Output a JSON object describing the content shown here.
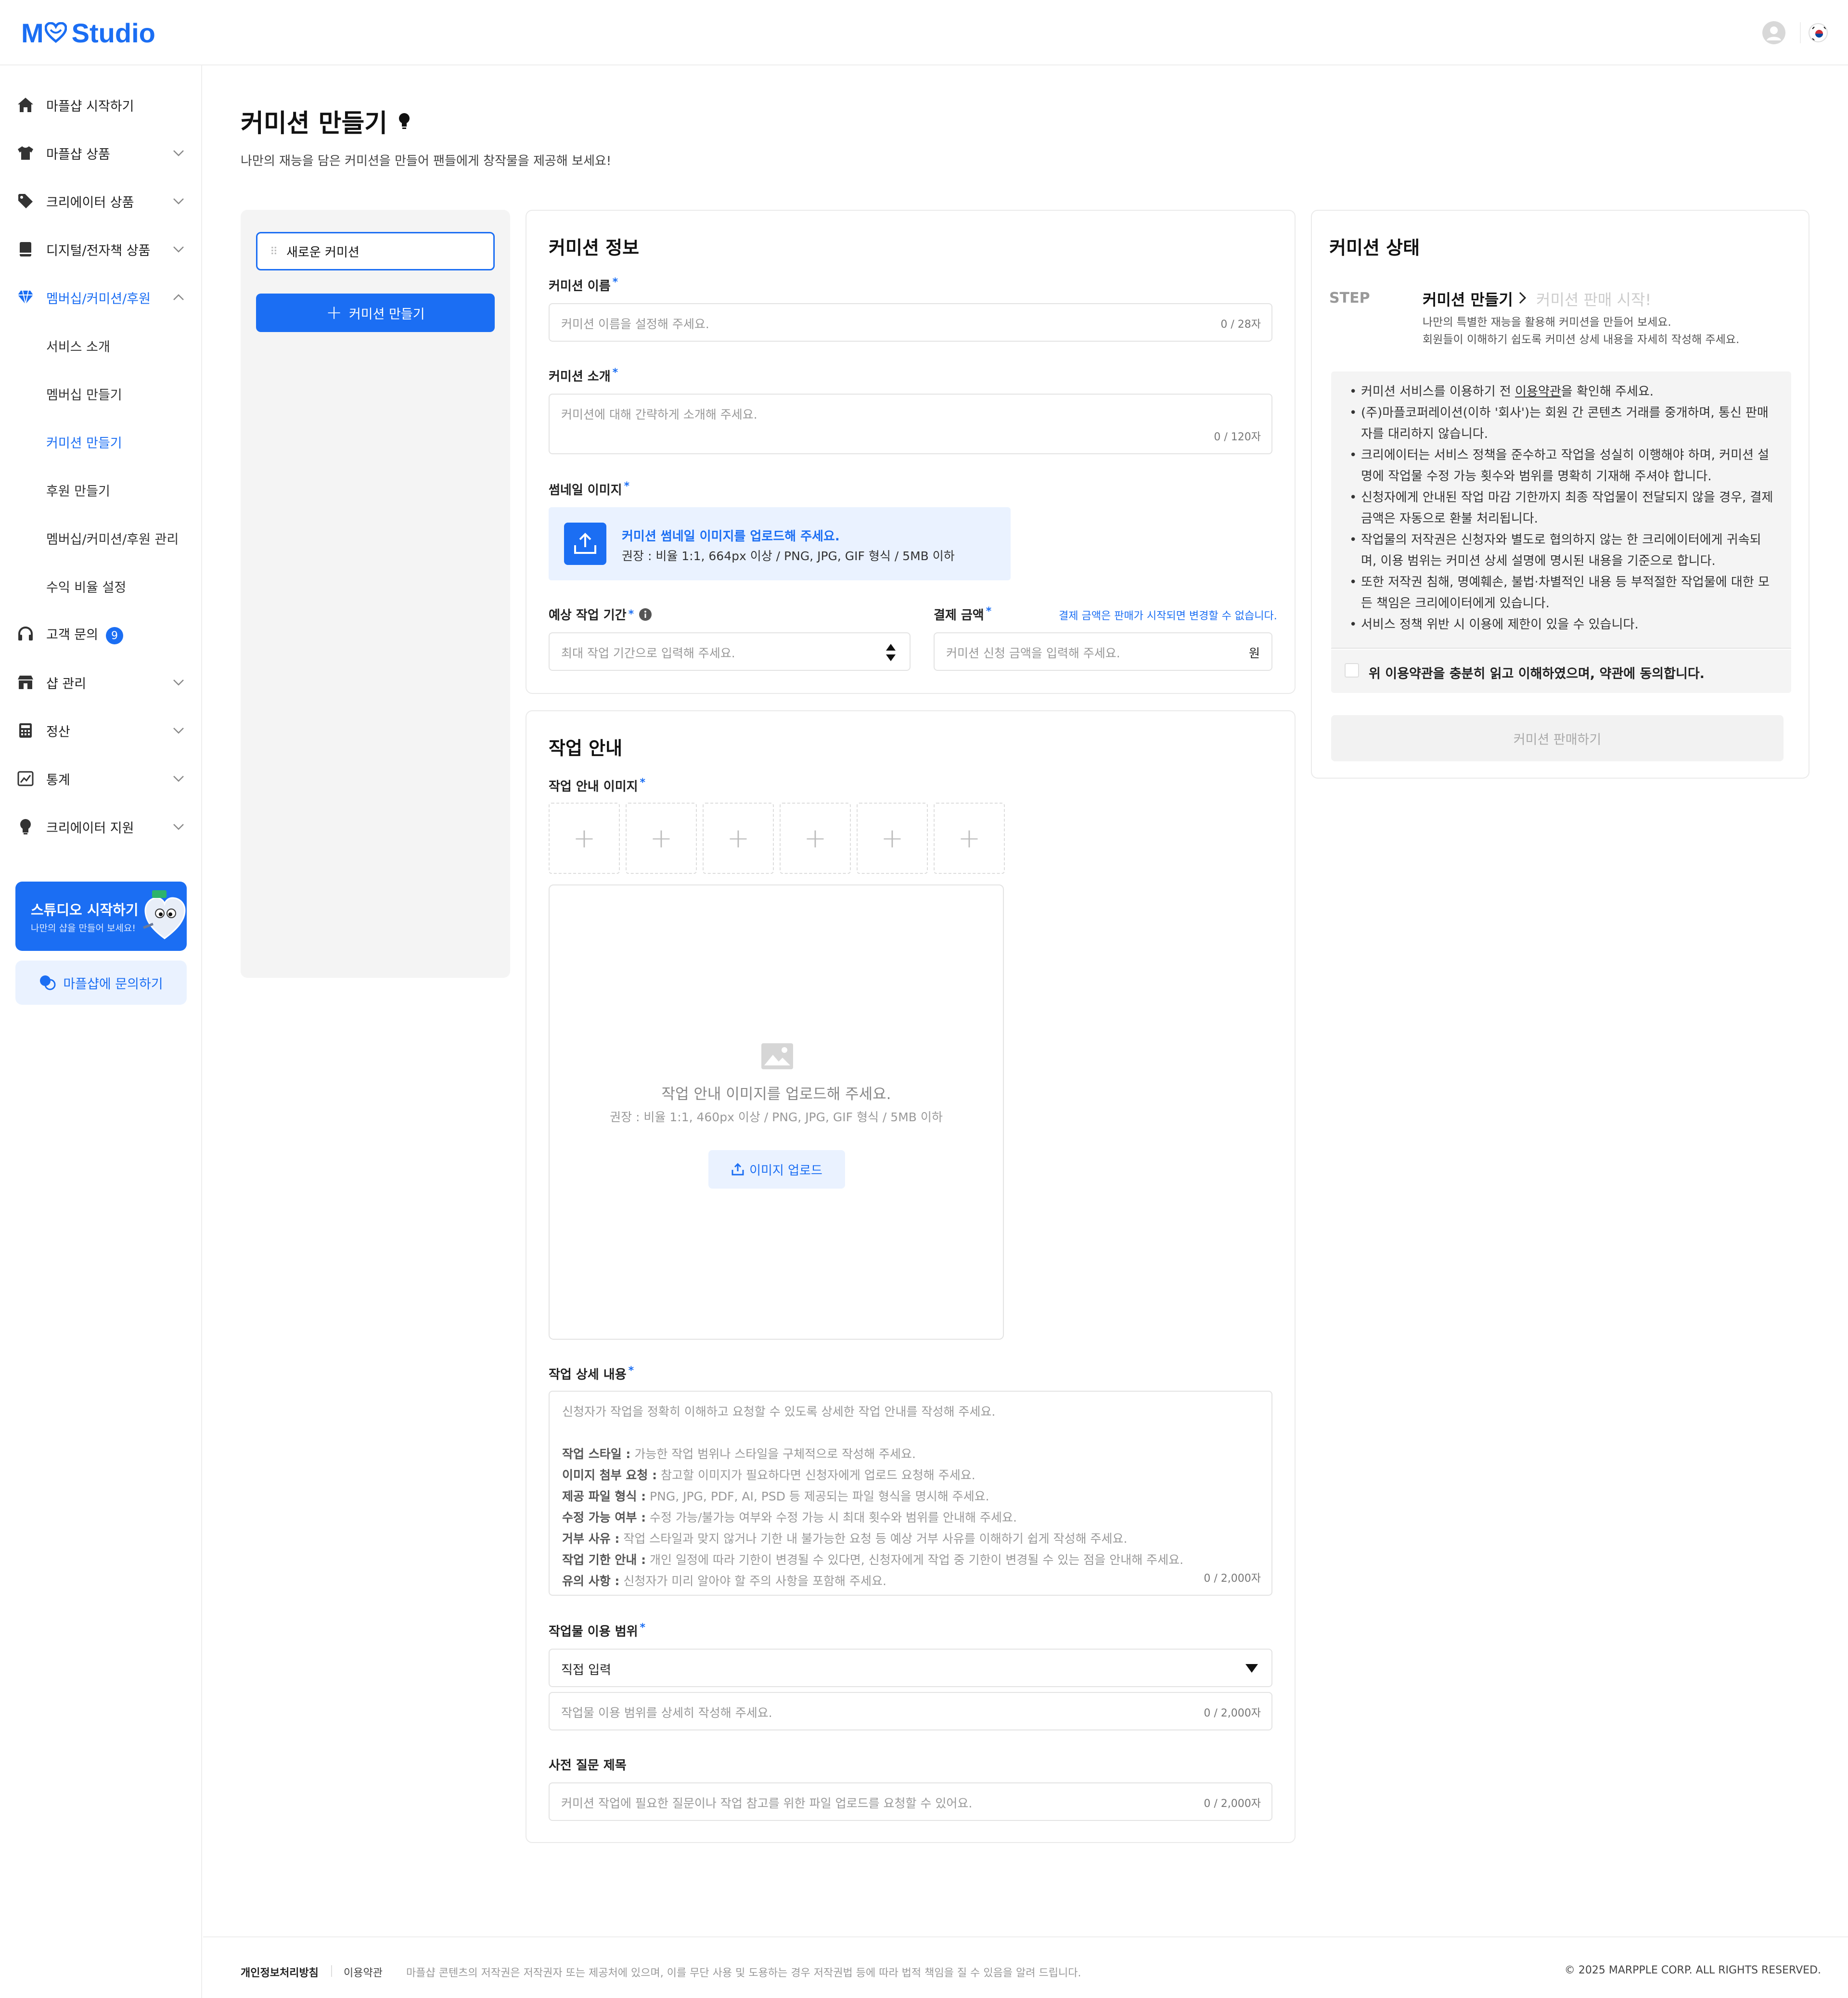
{
  "header": {
    "logo_text": "Studio",
    "logo_prefix": "M",
    "brand_color": "#1b6ef3",
    "avatar_icon": "user-avatar-icon",
    "language_icon": "korea-flag-icon"
  },
  "sidebar": {
    "items": [
      {
        "label": "마플샵 시작하기",
        "icon": "home-icon"
      },
      {
        "label": "마플샵 상품",
        "icon": "tshirt-icon"
      },
      {
        "label": "크리에이터 상품",
        "icon": "tag-icon"
      },
      {
        "label": "디지털/전자책 상품",
        "icon": "book-icon"
      },
      {
        "label": "멤버십/커미션/후원",
        "icon": "diamond-icon"
      },
      {
        "label": "고객 문의",
        "icon": "headset-icon",
        "badge": "9"
      },
      {
        "label": "샵 관리",
        "icon": "store-icon"
      },
      {
        "label": "정산",
        "icon": "calculator-icon"
      },
      {
        "label": "통계",
        "icon": "chart-icon"
      },
      {
        "label": "크리에이터 지원",
        "icon": "bulb-icon"
      }
    ],
    "sub_items": [
      "서비스 소개",
      "멤버십 만들기",
      "커미션 만들기",
      "후원 만들기",
      "멤버십/커미션/후원 관리",
      "수익 비율 설정"
    ],
    "promo": {
      "title": "스튜디오 시작하기",
      "subtitle": "나만의 샵을 만들어 보세요!"
    },
    "ask_label": "마플샵에 문의하기"
  },
  "page": {
    "title": "커미션 만들기",
    "subtitle": "나만의 재능을 담은 커미션을 만들어 팬들에게 창작물을 제공해 보세요!"
  },
  "left_panel": {
    "tab_label": "새로운 커미션",
    "create_button": "커미션 만들기"
  },
  "info": {
    "section_title": "커미션 정보",
    "name_label": "커미션 이름",
    "name_placeholder": "커미션 이름을 설정해 주세요.",
    "name_count": "0 / 28자",
    "intro_label": "커미션 소개",
    "intro_placeholder": "커미션에 대해 간략하게 소개해 주세요.",
    "intro_count": "0 / 120자",
    "thumb_label": "썸네일 이미지",
    "thumb_title": "커미션 썸네일 이미지를 업로드해 주세요.",
    "thumb_desc": "권장 : 비율 1:1, 664px 이상 / PNG, JPG, GIF 형식 / 5MB 이하",
    "period_label": "예상 작업 기간",
    "period_placeholder": "최대 작업 기간으로 입력해 주세요.",
    "price_label": "결제 금액",
    "price_note": "결제 금액은 판매가 시작되면 변경할 수 없습니다.",
    "price_placeholder": "커미션 신청 금액을 입력해 주세요.",
    "price_unit": "원"
  },
  "guide": {
    "section_title": "작업 안내",
    "image_label": "작업 안내 이미지",
    "upload_title": "작업 안내 이미지를 업로드해 주세요.",
    "upload_desc": "권장 : 비율 1:1, 460px 이상 / PNG, JPG, GIF 형식 / 5MB 이하",
    "upload_button": "이미지 업로드",
    "detail_label": "작업 상세 내용",
    "detail_intro": "신청자가 작업을 정확히 이해하고 요청할 수 있도록 상세한 작업 안내를 작성해 주세요.",
    "detail_lines": [
      {
        "k": "작업 스타일 :",
        "v": " 가능한 작업 범위나 스타일을 구체적으로 작성해 주세요."
      },
      {
        "k": "이미지 첨부 요청 :",
        "v": " 참고할 이미지가 필요하다면 신청자에게 업로드 요청해 주세요."
      },
      {
        "k": "제공 파일 형식 :",
        "v": " PNG, JPG, PDF, AI, PSD 등 제공되는 파일 형식을 명시해 주세요."
      },
      {
        "k": "수정 가능 여부 :",
        "v": " 수정 가능/불가능 여부와 수정 가능 시 최대 횟수와 범위를 안내해 주세요."
      },
      {
        "k": "거부 사유 :",
        "v": " 작업 스타일과 맞지 않거나 기한 내 불가능한 요청 등 예상 거부 사유를 이해하기 쉽게 작성해 주세요."
      },
      {
        "k": "작업 기한 안내 :",
        "v": " 개인 일정에 따라 기한이 변경될 수 있다면, 신청자에게 작업 중 기한이 변경될 수 있는 점을 안내해 주세요."
      },
      {
        "k": "유의 사항 :",
        "v": " 신청자가 미리 알아야 할 주의 사항을 포함해 주세요."
      }
    ],
    "detail_count": "0 / 2,000자",
    "scope_label": "작업물 이용 범위",
    "scope_select": "직접 입력",
    "scope_placeholder": "작업물 이용 범위를 상세히 작성해 주세요.",
    "scope_count": "0 / 2,000자",
    "question_label": "사전 질문 제목",
    "question_placeholder": "커미션 작업에 필요한 질문이나 작업 참고를 위한 파일 업로드를 요청할 수 있어요.",
    "question_count": "0 / 2,000자"
  },
  "status": {
    "section_title": "커미션 상태",
    "step_label": "STEP",
    "step1": "커미션 만들기",
    "step2": "커미션 판매 시작!",
    "step_desc1": "나만의 특별한 재능을 활용해 커미션을 만들어 보세요.",
    "step_desc2": "회원들이 이해하기 쉽도록 커미션 상세 내용을 자세히 작성해 주세요.",
    "terms": [
      {
        "pre": "커미션 서비스를 이용하기 전 ",
        "link": "이용약관",
        "post": "을 확인해 주세요."
      },
      {
        "pre": "(주)마플코퍼레이션(이하 '회사')는 회원 간 콘텐츠 거래를 중개하며, 통신 판매자를 대리하지 않습니다.",
        "link": "",
        "post": ""
      },
      {
        "pre": "크리에이터는 서비스 정책을 준수하고 작업을 성실히 이행해야 하며, 커미션 설명에 작업물 수정 가능 횟수와 범위를 명확히 기재해 주셔야 합니다.",
        "link": "",
        "post": ""
      },
      {
        "pre": "신청자에게 안내된 작업 마감 기한까지 최종 작업물이 전달되지 않을 경우, 결제 금액은 자동으로 환불 처리됩니다.",
        "link": "",
        "post": ""
      },
      {
        "pre": "작업물의 저작권은 신청자와 별도로 협의하지 않는 한 크리에이터에게 귀속되며, 이용 범위는 커미션 상세 설명에 명시된 내용을 기준으로 합니다.",
        "link": "",
        "post": ""
      },
      {
        "pre": "또한 저작권 침해, 명예훼손, 불법·차별적인 내용 등 부적절한 작업물에 대한 모든 책임은 크리에이터에게 있습니다.",
        "link": "",
        "post": ""
      },
      {
        "pre": "서비스 정책 위반 시 이용에 제한이 있을 수 있습니다.",
        "link": "",
        "post": ""
      }
    ],
    "agree_label": "위 이용약관을 충분히 읽고 이해하였으며, 약관에 동의합니다.",
    "sell_button": "커미션 판매하기"
  },
  "footer": {
    "privacy": "개인정보처리방침",
    "terms": "이용약관",
    "notice": "마플샵 콘텐츠의 저작권은 저작권자 또는 제공처에 있으며, 이를 무단 사용 및 도용하는 경우 저작권법 등에 따라 법적 책임을 질 수 있음을 알려 드립니다.",
    "copyright": "© 2025 MARPPLE CORP. ALL RIGHTS RESERVED."
  }
}
